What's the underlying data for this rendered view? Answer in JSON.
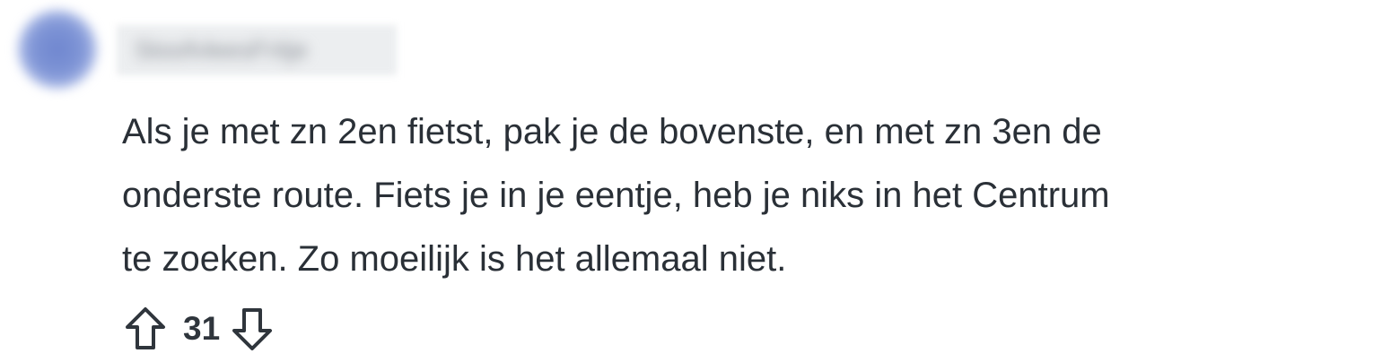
{
  "author": {
    "username": "StoofvleesFritje"
  },
  "comment": {
    "lines": [
      "Als je met zn 2en fietst, pak je de bovenste, en met zn 3en de",
      "onderste route. Fiets je in je eentje, heb je niks in het Centrum",
      "te zoeken. Zo moeilijk is het allemaal niet."
    ]
  },
  "actions": {
    "score": "31",
    "upvote_icon": "arrow-up-outline",
    "downvote_icon": "arrow-down-outline"
  },
  "colors": {
    "text": "#2a3037",
    "icon": "#2f353c",
    "avatar": "#7388d0"
  }
}
